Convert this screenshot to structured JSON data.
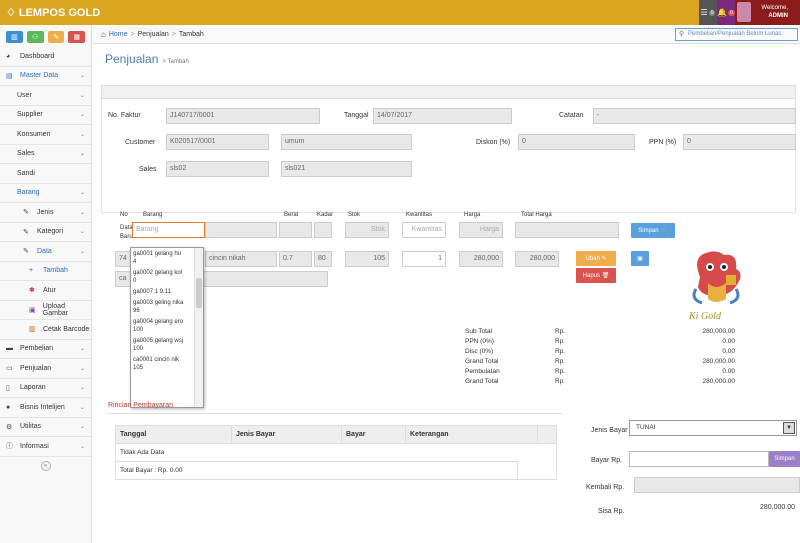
{
  "app": {
    "logo_text": "LEMPOS GOLD"
  },
  "header": {
    "badges": [
      {
        "icon": "list-icon",
        "count": "0",
        "color": "#555555"
      },
      {
        "icon": "bell-icon",
        "count": "0",
        "color": "#7a2a7a"
      }
    ],
    "user": {
      "welcome": "Welcome,",
      "name": "ADMIN"
    }
  },
  "sidebar": {
    "buttons": [
      {
        "icon": "bar-chart-icon",
        "color": "#3a8fd1"
      },
      {
        "icon": "users-icon",
        "color": "#5cb85c"
      },
      {
        "icon": "pencil-icon",
        "color": "#f0ad4e"
      },
      {
        "icon": "grid-icon",
        "color": "#d9534f"
      }
    ],
    "items": [
      {
        "label": "Dashboard",
        "icon": "dashboard-icon"
      },
      {
        "label": "Master Data",
        "icon": "database-icon"
      },
      {
        "label": "User"
      },
      {
        "label": "Supplier"
      },
      {
        "label": "Konsumen"
      },
      {
        "label": "Sales"
      },
      {
        "label": "Sandi"
      },
      {
        "label": "Barang"
      },
      {
        "label": "Jenis"
      },
      {
        "label": "Kategori"
      },
      {
        "label": "Data"
      },
      {
        "label": "Tambah"
      },
      {
        "label": "Atur"
      },
      {
        "label": "Upload Gambar"
      },
      {
        "label": "Cetak Barcode"
      },
      {
        "label": "Pembelian"
      },
      {
        "label": "Penjualan"
      },
      {
        "label": "Laporan"
      },
      {
        "label": "Bisnis Intelijen"
      },
      {
        "label": "Utilitas"
      },
      {
        "label": "Informasi"
      }
    ]
  },
  "breadcrumb": {
    "home": "Home",
    "sep": ">",
    "section": "Penjualan",
    "page": "Tambah"
  },
  "search": {
    "placeholder": "Pembelian/Penjualan Belum Lunas"
  },
  "page": {
    "title": "Penjualan",
    "subtitle": "> Tambah"
  },
  "form": {
    "no_faktur_label": "No. Faktur",
    "no_faktur": "J140717/0001",
    "tanggal_label": "Tanggal",
    "tanggal": "14/07/2017",
    "catatan_label": "Catatan",
    "catatan": "-",
    "customer_label": "Customer",
    "customer_code": "K020517/0001",
    "customer_name": "umum",
    "diskon_label": "Diskon (%)",
    "diskon": "0",
    "ppn_label": "PPN (%)",
    "ppn": "0",
    "sales_label": "Sales",
    "sales_code": "sls02",
    "sales_name": "sls021"
  },
  "items_table": {
    "headers": {
      "no": "No",
      "barang": "Barang",
      "berat": "Berat",
      "kadar": "Kadar",
      "stok": "Stok",
      "kwantitas": "Kwantitas",
      "harga": "Harga",
      "total": "Total Harga"
    },
    "new_row": {
      "label1": "Data",
      "label2": "Baru",
      "barang_ph": "Barang",
      "berat": "",
      "kadar": "",
      "stok_ph": "Stok",
      "kwantitas_ph": "Kwantitas",
      "harga_ph": "Harga",
      "total": ""
    },
    "row": {
      "no": "74",
      "barang_code": "ca",
      "barang_name": "cincin nikah",
      "berat": "0.7",
      "kadar": "80",
      "stok": "105",
      "kwantitas": "1",
      "harga": "280,000",
      "total": "280,000"
    },
    "simpan_label": "Simpan",
    "ubah_label": "Ubah",
    "hapus_label": "Hapus"
  },
  "dropdown": [
    {
      "code": "ga0001",
      "name": "gelang hu",
      "stock": "4"
    },
    {
      "code": "ga0002",
      "name": "gelang kol",
      "stock": "0"
    },
    {
      "code": "ga0007",
      "name": "1   9.11",
      "stock": ""
    },
    {
      "code": "ga0003",
      "name": "geling nika",
      "stock": "96"
    },
    {
      "code": "ga0004",
      "name": "gelang ero",
      "stock": "100"
    },
    {
      "code": "ga0005",
      "name": "gelang wsj",
      "stock": "100"
    },
    {
      "code": "ca0001",
      "name": "cincin nik",
      "stock": "105"
    }
  ],
  "summary": {
    "currency": "Rp.",
    "rows": [
      {
        "label": "Sub Total",
        "value": "280,000.00"
      },
      {
        "label": "PPN (0%)",
        "value": "0.00"
      },
      {
        "label": "Disc (0%)",
        "value": "0.00"
      },
      {
        "label": "Grand Total",
        "value": "280,000.00"
      },
      {
        "label": "Pembulatan",
        "value": "0.00"
      },
      {
        "label": "Grand Total",
        "value": "280,000.00"
      }
    ]
  },
  "payments": {
    "title": "Rincian Pembayaran",
    "headers": [
      "Tanggal",
      "Jenis Bayar",
      "Bayar",
      "Keterangan"
    ],
    "empty_text": "Tidak Ada Data",
    "total_text": "Total Bayar  :  Rp.    0.00"
  },
  "pay_form": {
    "jenis_label": "Jenis Bayar",
    "jenis_value": "TUNAI",
    "bayar_label": "Bayar Rp.",
    "simpan_label": "Simpan",
    "kembali_label": "Kembali Rp.",
    "sisa_label": "Sisa Rp.",
    "sisa_value": "280,000.00"
  },
  "mascot": {
    "text": "Ki Gold"
  }
}
